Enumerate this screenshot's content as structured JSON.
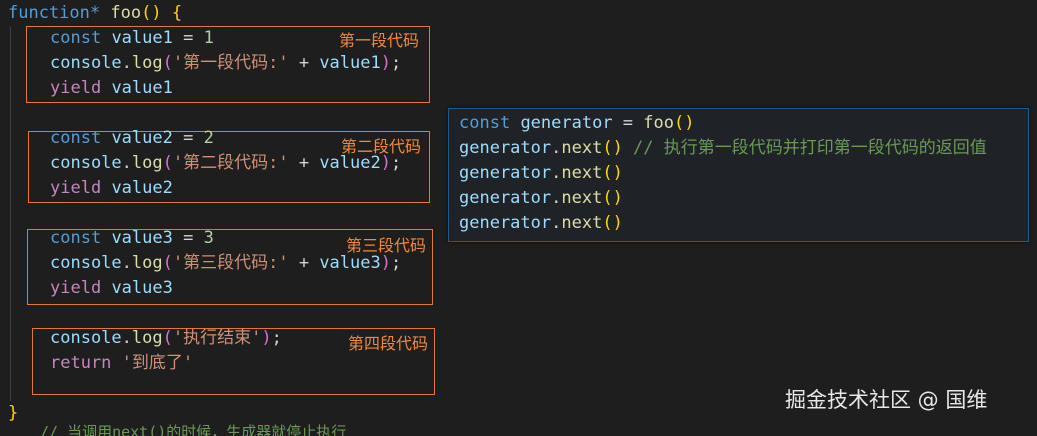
{
  "code": {
    "header": {
      "kw": "function",
      "star": "*",
      "name": "foo",
      "parens": "()",
      "brace": "{"
    },
    "block1": {
      "decl_kw": "const",
      "decl_name": "value1",
      "decl_eq": " = ",
      "decl_val": "1",
      "log_obj": "console",
      "log_dot": ".",
      "log_fn": "log",
      "open": "(",
      "str": "'第一段代码:'",
      "plus": " + ",
      "arg": "value1",
      "close": ")",
      "semi": ";",
      "yield_kw": "yield",
      "yield_val": "value1",
      "label": "第一段代码"
    },
    "block2": {
      "decl_kw": "const",
      "decl_name": "value2",
      "decl_eq": " = ",
      "decl_val": "2",
      "log_obj": "console",
      "log_dot": ".",
      "log_fn": "log",
      "open": "(",
      "str": "'第二段代码:'",
      "plus": " + ",
      "arg": "value2",
      "close": ")",
      "semi": ";",
      "yield_kw": "yield",
      "yield_val": "value2",
      "label": "第二段代码"
    },
    "block3": {
      "decl_kw": "const",
      "decl_name": "value3",
      "decl_eq": " = ",
      "decl_val": "3",
      "log_obj": "console",
      "log_dot": ".",
      "log_fn": "log",
      "open": "(",
      "str": "'第三段代码:'",
      "plus": " + ",
      "arg": "value3",
      "close": ")",
      "semi": ";",
      "yield_kw": "yield",
      "yield_val": "value3",
      "label": "第三段代码"
    },
    "block4": {
      "log_obj": "console",
      "log_dot": ".",
      "log_fn": "log",
      "open": "(",
      "str": "'执行结束'",
      "close": ")",
      "semi": ";",
      "return_kw": "return",
      "return_val": "'到底了'",
      "label": "第四段代码"
    },
    "footer": {
      "brace": "}"
    },
    "cutoff_text": "// 当调用next()的时候，生成器就停止执行"
  },
  "popup": {
    "line1": {
      "kw": "const",
      "name": "generator",
      "eq": " = ",
      "fn": "foo",
      "parens": "()"
    },
    "calls": [
      {
        "obj": "generator",
        "dot": ".",
        "fn": "next",
        "parens": "()",
        "comment": " // 执行第一段代码并打印第一段代码的返回值"
      },
      {
        "obj": "generator",
        "dot": ".",
        "fn": "next",
        "parens": "()",
        "comment": ""
      },
      {
        "obj": "generator",
        "dot": ".",
        "fn": "next",
        "parens": "()",
        "comment": ""
      },
      {
        "obj": "generator",
        "dot": ".",
        "fn": "next",
        "parens": "()",
        "comment": ""
      }
    ]
  },
  "watermark": "掘金技术社区 @ 国维"
}
